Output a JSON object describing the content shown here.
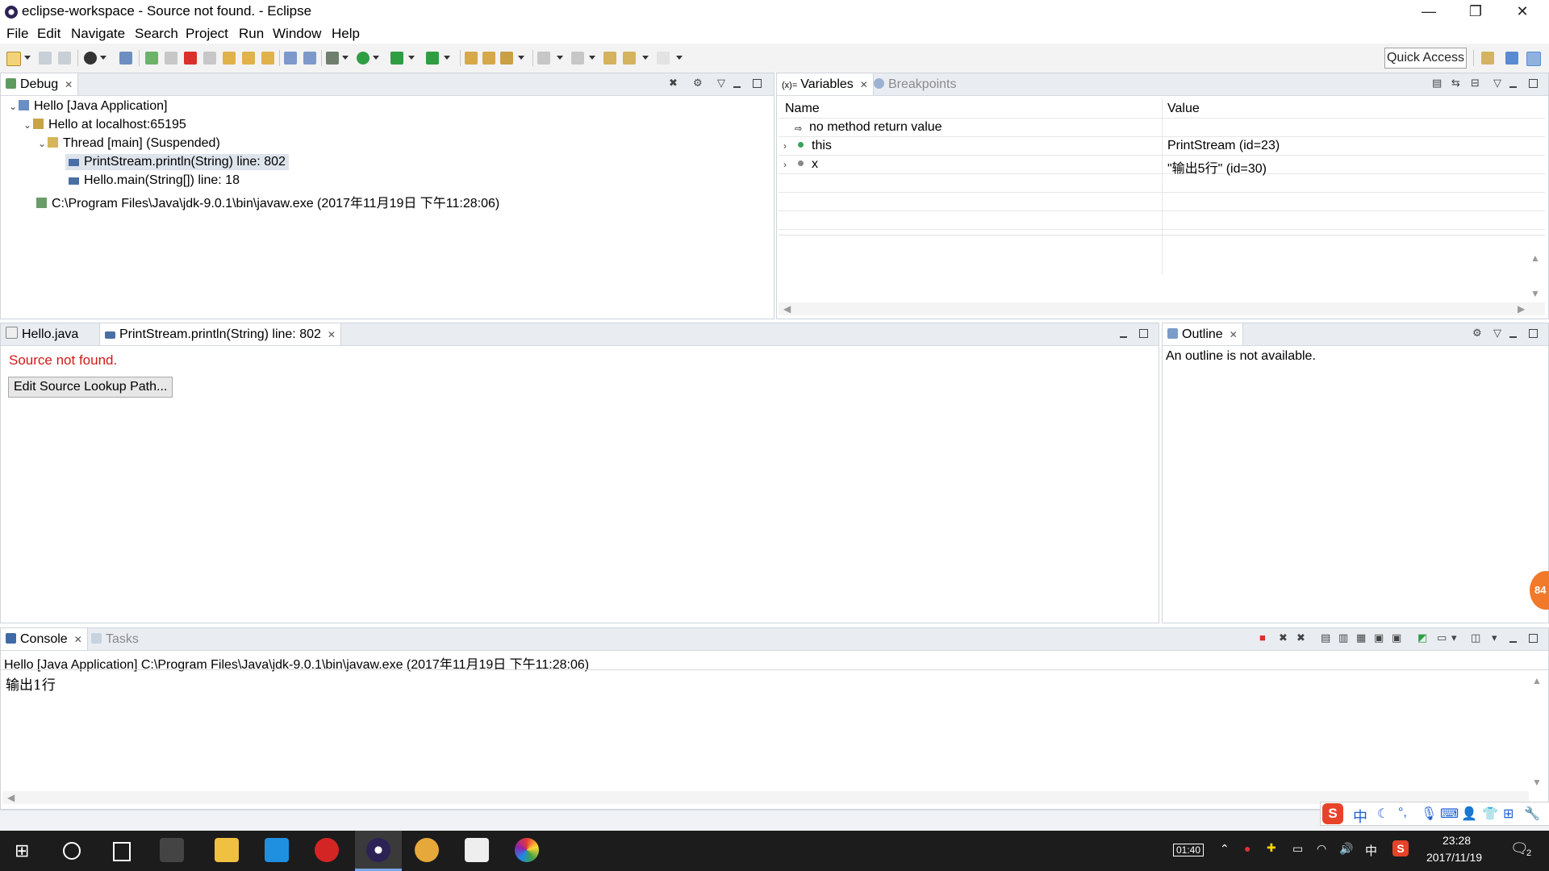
{
  "window": {
    "title": "eclipse-workspace - Source not found. - Eclipse",
    "minimize": "—",
    "restore": "❐",
    "close": "✕"
  },
  "menu": [
    "File",
    "Edit",
    "Navigate",
    "Search",
    "Project",
    "Run",
    "Window",
    "Help"
  ],
  "toolbar": {
    "quick_access": "Quick Access"
  },
  "debug": {
    "tab": "Debug",
    "tree": [
      {
        "label": "Hello [Java Application]"
      },
      {
        "label": "Hello at localhost:65195"
      },
      {
        "label": "Thread [main] (Suspended)"
      },
      {
        "label": "PrintStream.println(String) line: 802"
      },
      {
        "label": "Hello.main(String[]) line: 18"
      },
      {
        "label": "C:\\Program Files\\Java\\jdk-9.0.1\\bin\\javaw.exe (2017年11月19日 下午11:28:06)"
      }
    ]
  },
  "variables": {
    "tabs": [
      "Variables",
      "Breakpoints"
    ],
    "columns": [
      "Name",
      "Value"
    ],
    "rows": [
      {
        "name": "no method return value",
        "value": ""
      },
      {
        "name": "this",
        "value": "PrintStream  (id=23)"
      },
      {
        "name": "x",
        "value": "\"输出5行\" (id=30)"
      }
    ]
  },
  "editor": {
    "tabs": [
      "Hello.java",
      "PrintStream.println(String) line: 802"
    ],
    "message": "Source not found.",
    "button": "Edit Source Lookup Path..."
  },
  "outline": {
    "tab": "Outline",
    "message": "An outline is not available."
  },
  "console": {
    "tabs": [
      "Console",
      "Tasks"
    ],
    "header": "Hello [Java Application] C:\\Program Files\\Java\\jdk-9.0.1\\bin\\javaw.exe (2017年11月19日 下午11:28:06)",
    "output": "输出1行"
  },
  "side_badge": "84",
  "ime": {
    "lang": "中"
  },
  "tray": {
    "battery_time": "01:40",
    "lang": "中",
    "time": "23:28",
    "date": "2017/11/19",
    "notifications": "2"
  }
}
